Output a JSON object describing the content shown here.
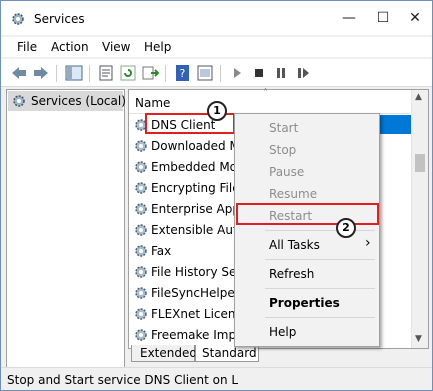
{
  "window": {
    "title": "Services",
    "minimize": "—",
    "maximize": "☐",
    "close": "✕"
  },
  "menu": [
    "File",
    "Action",
    "View",
    "Help"
  ],
  "tree": {
    "item": "Services (Local)"
  },
  "list": {
    "column": "Name",
    "rows": [
      "DNS Client",
      "Downloaded Ma",
      "Embedded Mod",
      "Encrypting File S",
      "Enterprise App M",
      "Extensible Auth",
      "Fax",
      "File History Serv",
      "FileSyncHelper",
      "FLEXnet Licensin",
      "Freemake Impro"
    ]
  },
  "context_menu": {
    "start": "Start",
    "stop": "Stop",
    "pause": "Pause",
    "resume": "Resume",
    "restart": "Restart",
    "all_tasks": "All Tasks",
    "all_tasks_arrow": "›",
    "refresh": "Refresh",
    "properties": "Properties",
    "help": "Help"
  },
  "tabs": {
    "extended": "Extended",
    "standard": "Standard"
  },
  "status": "Stop and Start service DNS Client on L",
  "badges": {
    "one": "1",
    "two": "2"
  },
  "colors": {
    "highlight_red": "#e02020",
    "selection_blue": "#0078d7"
  }
}
